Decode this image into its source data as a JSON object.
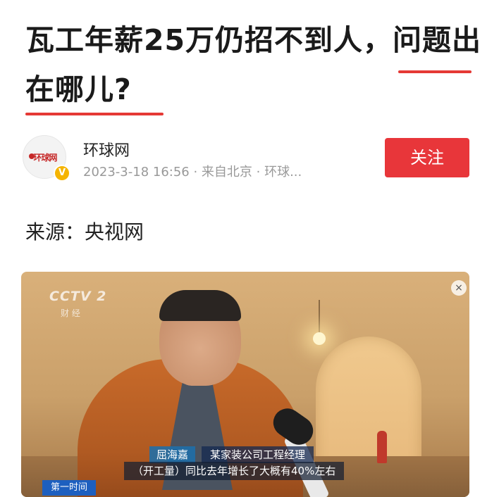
{
  "article": {
    "title": "瓦工年薪25万仍招不到人，问题出在哪儿?"
  },
  "author": {
    "name": "环球网",
    "avatar_text": "环球网",
    "verified_mark": "V",
    "meta": "2023-3-18 16:56 · 来自北京 · 环球...",
    "follow_label": "关注"
  },
  "source": {
    "text": "来源：央视网"
  },
  "video": {
    "logo": "CCTV 2",
    "channel_tag": "财 经",
    "close_icon": "×",
    "caption_name": "屈海嘉",
    "caption_role": "某家装公司工程经理",
    "caption_sub": "（开工量）同比去年增长了大概有40%左右",
    "program_tag": "第一时间"
  },
  "colors": {
    "accent_red": "#e8363a",
    "underline_red": "#e53935",
    "meta_gray": "#999999"
  }
}
